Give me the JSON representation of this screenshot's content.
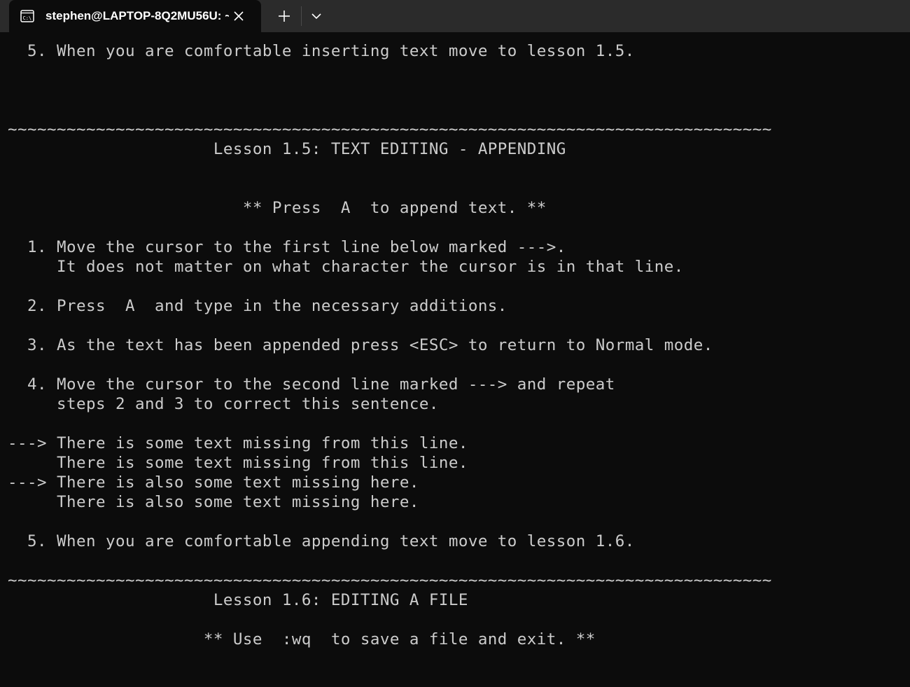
{
  "tab": {
    "title": "stephen@LAPTOP-8Q2MU56U: ~",
    "icon": "terminal-icon",
    "close_icon": "close-icon"
  },
  "toolbar": {
    "new_tab_icon": "plus-icon",
    "dropdown_icon": "chevron-down-icon"
  },
  "colors": {
    "terminal_bg": "#0c0c0c",
    "terminal_fg": "#cccccc",
    "titlebar_bg": "#2b2b2b"
  },
  "terminal": {
    "lines": [
      "  5. When you are comfortable inserting text move to lesson 1.5.",
      "",
      "",
      "",
      "~~~~~~~~~~~~~~~~~~~~~~~~~~~~~~~~~~~~~~~~~~~~~~~~~~~~~~~~~~~~~~~~~~~~~~~~~~~~~~",
      "                     Lesson 1.5: TEXT EDITING - APPENDING",
      "",
      "",
      "                        ** Press  A  to append text. **",
      "",
      "  1. Move the cursor to the first line below marked --->.",
      "     It does not matter on what character the cursor is in that line.",
      "",
      "  2. Press  A  and type in the necessary additions.",
      "",
      "  3. As the text has been appended press <ESC> to return to Normal mode.",
      "",
      "  4. Move the cursor to the second line marked ---> and repeat",
      "     steps 2 and 3 to correct this sentence.",
      "",
      "---> There is some text missing from this line.",
      "     There is some text missing from this line.",
      "---> There is also some text missing here.",
      "     There is also some text missing here.",
      "",
      "  5. When you are comfortable appending text move to lesson 1.6.",
      "",
      "~~~~~~~~~~~~~~~~~~~~~~~~~~~~~~~~~~~~~~~~~~~~~~~~~~~~~~~~~~~~~~~~~~~~~~~~~~~~~~",
      "                     Lesson 1.6: EDITING A FILE",
      "",
      "                    ** Use  :wq  to save a file and exit. **",
      "",
      ""
    ]
  }
}
